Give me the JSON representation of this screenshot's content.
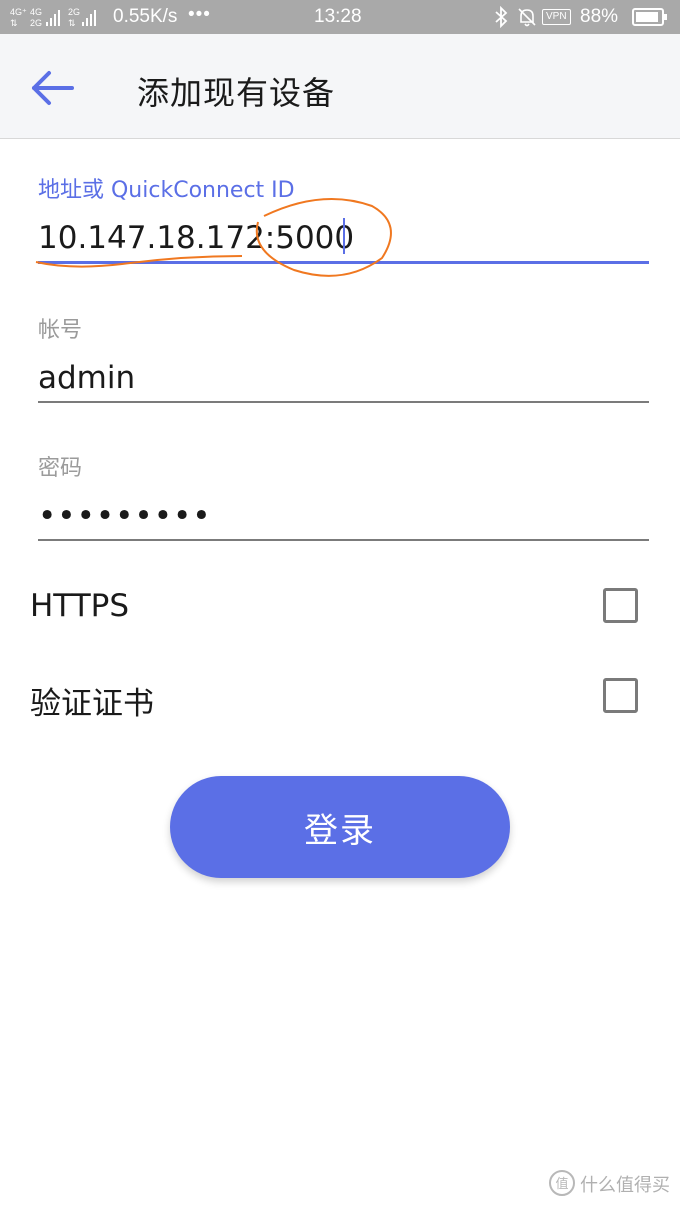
{
  "status_bar": {
    "network_speed": "0.55K/s",
    "overflow_indicator": "•••",
    "time": "13:28",
    "vpn_label": "VPN",
    "battery_percent": "88%",
    "net_labels": [
      "4G⁺",
      "4G",
      "2G",
      "2G"
    ]
  },
  "app_bar": {
    "title": "添加现有设备",
    "back_icon": "arrow-left-icon"
  },
  "form": {
    "address": {
      "label": "地址或 QuickConnect ID",
      "value": "10.147.18.172:5000"
    },
    "account": {
      "label": "帐号",
      "value": "admin"
    },
    "password": {
      "label": "密码",
      "value": "•••••••••"
    }
  },
  "options": {
    "https": {
      "label": "HTTPS",
      "checked": false
    },
    "verify_cert": {
      "label": "验证证书",
      "checked": false
    }
  },
  "login_button": {
    "label": "登录"
  },
  "watermark": {
    "text": "什么值得买"
  },
  "colors": {
    "accent": "#5b6fe6",
    "status_bar": "#a9a9a9",
    "annotation": "#f07820"
  }
}
